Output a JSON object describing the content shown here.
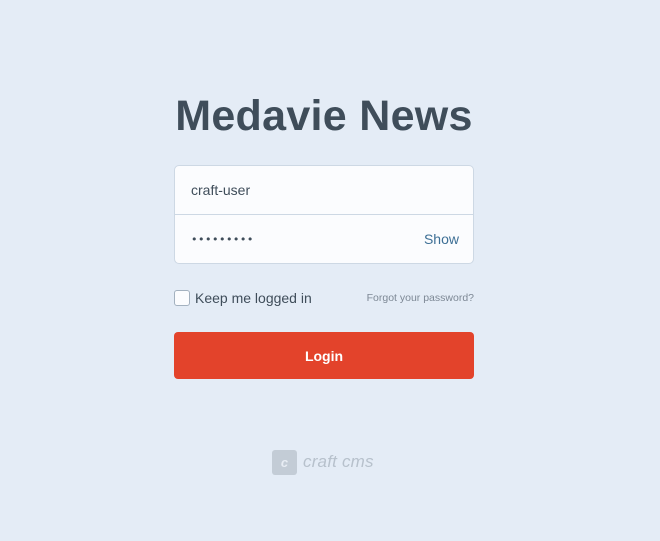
{
  "site": {
    "title": "Medavie News"
  },
  "login": {
    "username_value": "craft-user",
    "password_mask": "•••••••••",
    "show_label": "Show",
    "remember_label": "Keep me logged in",
    "remember_checked": false,
    "forgot_label": "Forgot your password?",
    "submit_label": "Login"
  },
  "footer": {
    "logo_letter": "c",
    "logo_text": "craft cms",
    "logo_icon": "craft-cms-logo-icon"
  },
  "colors": {
    "background": "#e4ecf6",
    "accent": "#e3432b",
    "link": "#3d6f95",
    "text": "#3f4d5a"
  }
}
